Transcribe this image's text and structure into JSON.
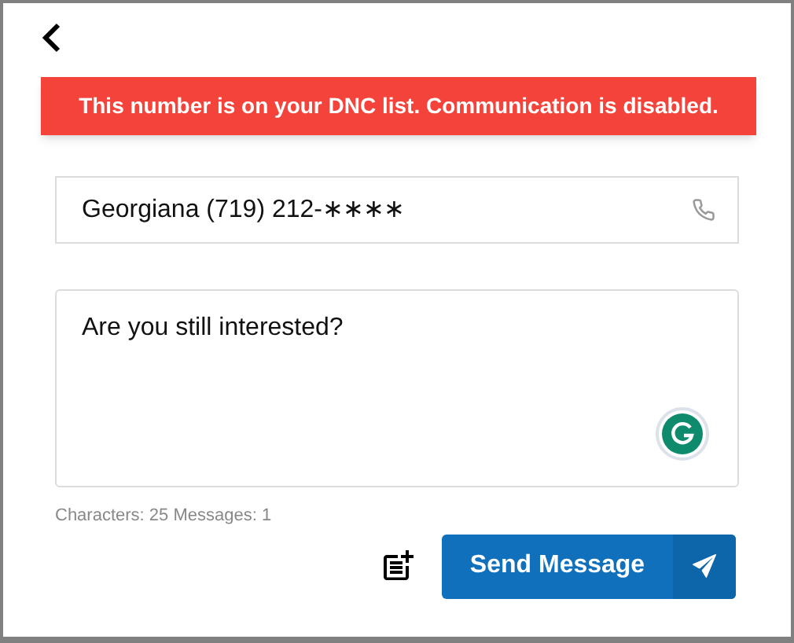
{
  "alert": {
    "text": "This number is on your DNC list. Communication is disabled."
  },
  "recipient": {
    "value": "Georgiana (719) 212-∗∗∗∗"
  },
  "message": {
    "value": "Are you still interested?"
  },
  "counter": "Characters: 25 Messages: 1",
  "send_button": {
    "label": "Send Message",
    "disabled": false
  }
}
